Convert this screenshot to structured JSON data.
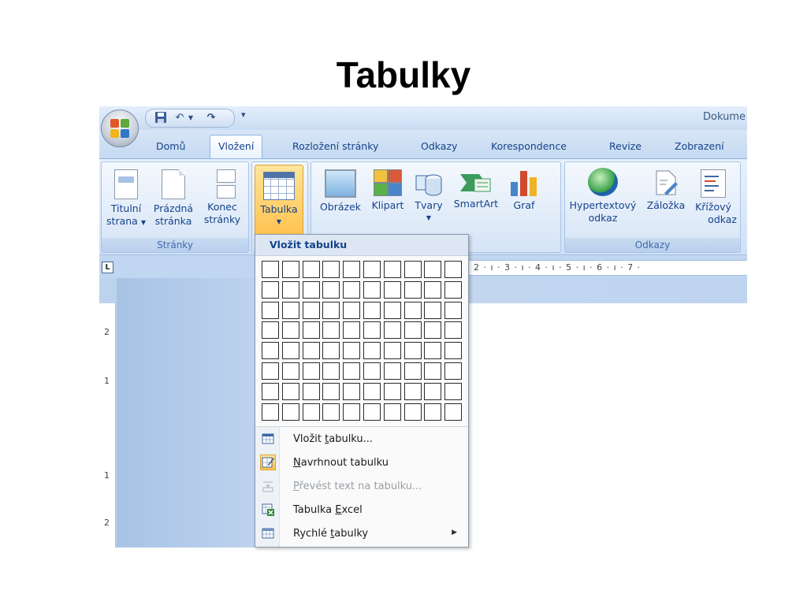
{
  "slide": {
    "title": "Tabulky"
  },
  "window": {
    "document_title": "Dokume"
  },
  "qat": {
    "save_icon": "save-icon",
    "undo_icon": "undo-icon",
    "redo_icon": "redo-icon",
    "customize_icon": "customize-qat-icon"
  },
  "tabs": [
    {
      "label": "Domů",
      "active": false
    },
    {
      "label": "Vložení",
      "active": true
    },
    {
      "label": "Rozložení stránky",
      "active": false
    },
    {
      "label": "Odkazy",
      "active": false
    },
    {
      "label": "Korespondence",
      "active": false
    },
    {
      "label": "Revize",
      "active": false
    },
    {
      "label": "Zobrazení",
      "active": false
    }
  ],
  "ribbon": {
    "groups": {
      "pages": "Stránky",
      "links": "Odkazy"
    },
    "buttons": {
      "cover_page": {
        "line1": "Titulní",
        "line2": "strana"
      },
      "blank_page": {
        "line1": "Prázdná",
        "line2": "stránka"
      },
      "page_break": {
        "line1": "Konec",
        "line2": "stránky"
      },
      "table": {
        "line1": "Tabulka"
      },
      "picture": {
        "line1": "Obrázek"
      },
      "clipart": {
        "line1": "Klipart"
      },
      "shapes": {
        "line1": "Tvary"
      },
      "smartart": {
        "line1": "SmartArt"
      },
      "chart": {
        "line1": "Graf"
      },
      "hyperlink": {
        "line1": "Hypertextový",
        "line2": "odkaz"
      },
      "bookmark": {
        "line1": "Záložka"
      },
      "crossref": {
        "line1": "Křížový",
        "line2": "odkaz"
      }
    }
  },
  "ruler": {
    "corner": "L",
    "horizontal": "· 2 · ı · 3 · ı · 4 · ı · 5 · ı · 6 · ı · 7 ·",
    "vertical_marks": [
      "2",
      "1",
      "1",
      "2"
    ]
  },
  "menu": {
    "header": "Vložit tabulku",
    "grid": {
      "columns": 10,
      "rows": 8
    },
    "items": [
      {
        "pre": "Vložit ",
        "key": "t",
        "post": "abulku...",
        "enabled": true
      },
      {
        "pre": "",
        "key": "N",
        "post": "avrhnout tabulku",
        "enabled": true
      },
      {
        "pre": "",
        "key": "P",
        "post": "řevést text na tabulku...",
        "enabled": false
      },
      {
        "pre": "Tabulka ",
        "key": "E",
        "post": "xcel",
        "enabled": true
      },
      {
        "pre": "Rychlé ",
        "key": "t",
        "post": "abulky",
        "enabled": true
      }
    ]
  },
  "colors": {
    "ribbon_text": "#15428b",
    "active_button": "#ffc04a",
    "group_label": "#3e6aaa"
  }
}
